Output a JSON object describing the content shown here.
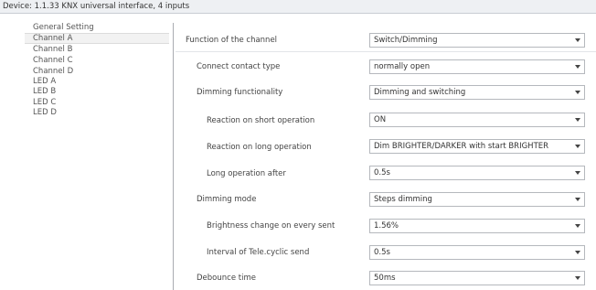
{
  "title": "Device: 1.1.33  KNX universal interface, 4 inputs",
  "nav": {
    "items": [
      {
        "label": "General Setting",
        "active": false
      },
      {
        "label": "Channel A",
        "active": true
      },
      {
        "label": "Channel B",
        "active": false
      },
      {
        "label": "Channel C",
        "active": false
      },
      {
        "label": "Channel D",
        "active": false
      },
      {
        "label": "LED A",
        "active": false
      },
      {
        "label": "LED B",
        "active": false
      },
      {
        "label": "LED C",
        "active": false
      },
      {
        "label": "LED D",
        "active": false
      }
    ]
  },
  "params": [
    {
      "label": "Function of the channel",
      "value": "Switch/Dimming"
    },
    {
      "label": "Connect contact type",
      "value": "normally open"
    },
    {
      "label": "Dimming functionality",
      "value": "Dimming and switching"
    },
    {
      "label": "Reaction on short operation",
      "value": "ON"
    },
    {
      "label": "Reaction on long operation",
      "value": "Dim BRIGHTER/DARKER with start BRIGHTER"
    },
    {
      "label": "Long operation after",
      "value": "0.5s"
    },
    {
      "label": "Dimming mode",
      "value": "Steps dimming"
    },
    {
      "label": "Brightness change on every sent",
      "value": "1.56%"
    },
    {
      "label": "Interval of Tele.cyclic send",
      "value": "0.5s"
    },
    {
      "label": "Debounce time",
      "value": "50ms"
    }
  ]
}
